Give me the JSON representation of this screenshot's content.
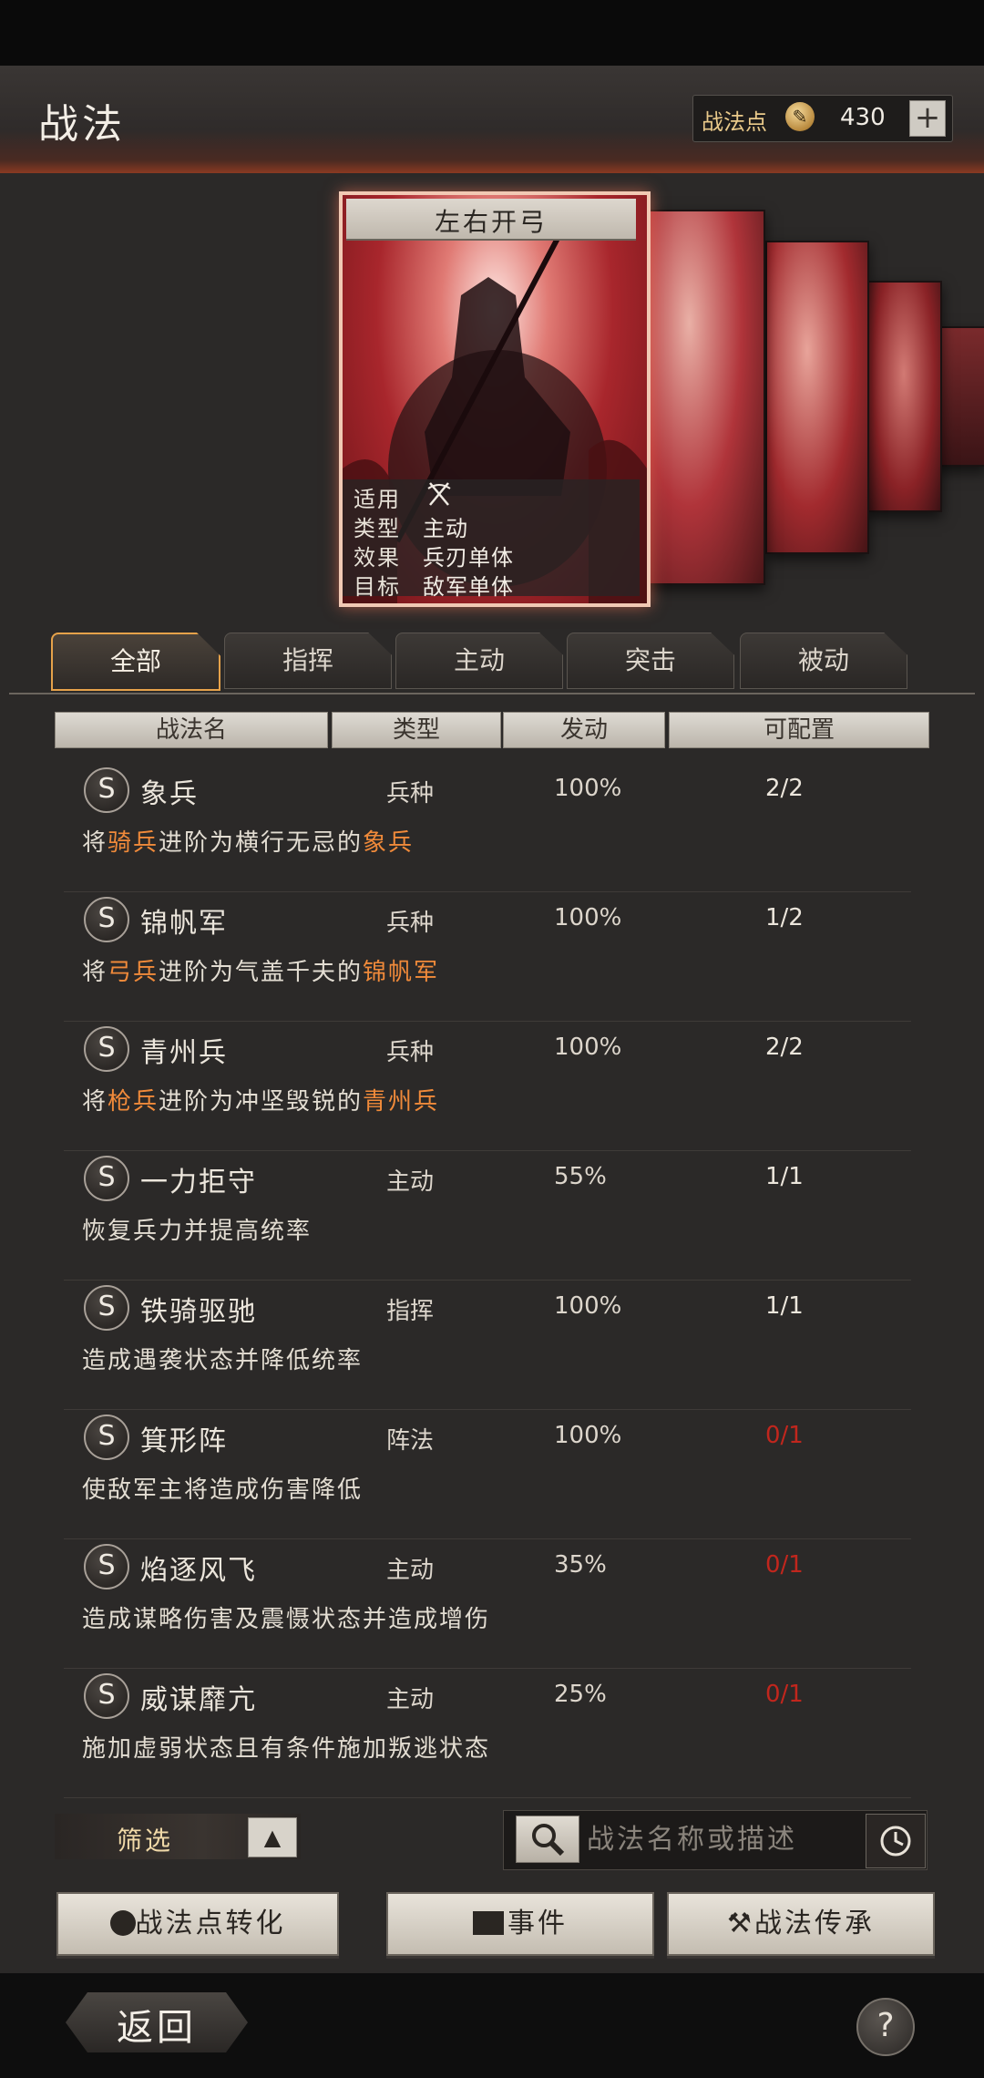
{
  "header": {
    "title": "战法",
    "points_label": "战法点",
    "points_value": "430",
    "add_label": "+"
  },
  "featured_card": {
    "name": "左右开弓",
    "info": [
      {
        "key": "适用",
        "value": ""
      },
      {
        "key": "类型",
        "value": "主动"
      },
      {
        "key": "效果",
        "value": "兵刃单体"
      },
      {
        "key": "目标",
        "value": "敌军单体"
      }
    ]
  },
  "tabs": [
    {
      "label": "全部",
      "active": true
    },
    {
      "label": "指挥",
      "active": false
    },
    {
      "label": "主动",
      "active": false
    },
    {
      "label": "突击",
      "active": false
    },
    {
      "label": "被动",
      "active": false
    }
  ],
  "columns": [
    "战法名",
    "类型",
    "发动",
    "可配置"
  ],
  "rows": [
    {
      "badge": "S",
      "name": "象兵",
      "type": "兵种",
      "rate": "100%",
      "alloc": "2/2",
      "alloc_red": false,
      "desc": [
        {
          "t": "将",
          "h": false
        },
        {
          "t": "骑兵",
          "h": true
        },
        {
          "t": "进阶为横行无忌的",
          "h": false
        },
        {
          "t": "象兵",
          "h": true
        }
      ]
    },
    {
      "badge": "S",
      "name": "锦帆军",
      "type": "兵种",
      "rate": "100%",
      "alloc": "1/2",
      "alloc_red": false,
      "desc": [
        {
          "t": "将",
          "h": false
        },
        {
          "t": "弓兵",
          "h": true
        },
        {
          "t": "进阶为气盖千夫的",
          "h": false
        },
        {
          "t": "锦帆军",
          "h": true
        }
      ]
    },
    {
      "badge": "S",
      "name": "青州兵",
      "type": "兵种",
      "rate": "100%",
      "alloc": "2/2",
      "alloc_red": false,
      "desc": [
        {
          "t": "将",
          "h": false
        },
        {
          "t": "枪兵",
          "h": true
        },
        {
          "t": "进阶为冲坚毁锐的",
          "h": false
        },
        {
          "t": "青州兵",
          "h": true
        }
      ]
    },
    {
      "badge": "S",
      "name": "一力拒守",
      "type": "主动",
      "rate": "55%",
      "alloc": "1/1",
      "alloc_red": false,
      "desc": [
        {
          "t": "恢复兵力并提高统率",
          "h": false
        }
      ]
    },
    {
      "badge": "S",
      "name": "铁骑驱驰",
      "type": "指挥",
      "rate": "100%",
      "alloc": "1/1",
      "alloc_red": false,
      "desc": [
        {
          "t": "造成遇袭状态并降低统率",
          "h": false
        }
      ]
    },
    {
      "badge": "S",
      "name": "箕形阵",
      "type": "阵法",
      "rate": "100%",
      "alloc": "0/1",
      "alloc_red": true,
      "desc": [
        {
          "t": "使敌军主将造成伤害降低",
          "h": false
        }
      ]
    },
    {
      "badge": "S",
      "name": "焰逐风飞",
      "type": "主动",
      "rate": "35%",
      "alloc": "0/1",
      "alloc_red": true,
      "desc": [
        {
          "t": "造成谋略伤害及震慑状态并造成增伤",
          "h": false
        }
      ]
    },
    {
      "badge": "S",
      "name": "威谋靡亢",
      "type": "主动",
      "rate": "25%",
      "alloc": "0/1",
      "alloc_red": true,
      "desc": [
        {
          "t": "施加虚弱状态且有条件施加叛逃状态",
          "h": false
        }
      ]
    }
  ],
  "filter": {
    "label": "筛选",
    "arrow": "▲"
  },
  "search": {
    "placeholder": "战法名称或描述"
  },
  "buttons": {
    "convert": "战法点转化",
    "event": "事件",
    "inherit": "战法传承"
  },
  "footer": {
    "back": "返回",
    "help": "?"
  },
  "colors": {
    "accent_orange": "#f08a3a",
    "alloc_red": "#c1261d",
    "tab_active_border": "#e6a24a"
  },
  "icons": [
    "coin-icon",
    "plus-icon",
    "bow-icon",
    "search-icon",
    "clock-icon",
    "convert-icon",
    "event-icon",
    "hammer-icon",
    "help-icon"
  ]
}
